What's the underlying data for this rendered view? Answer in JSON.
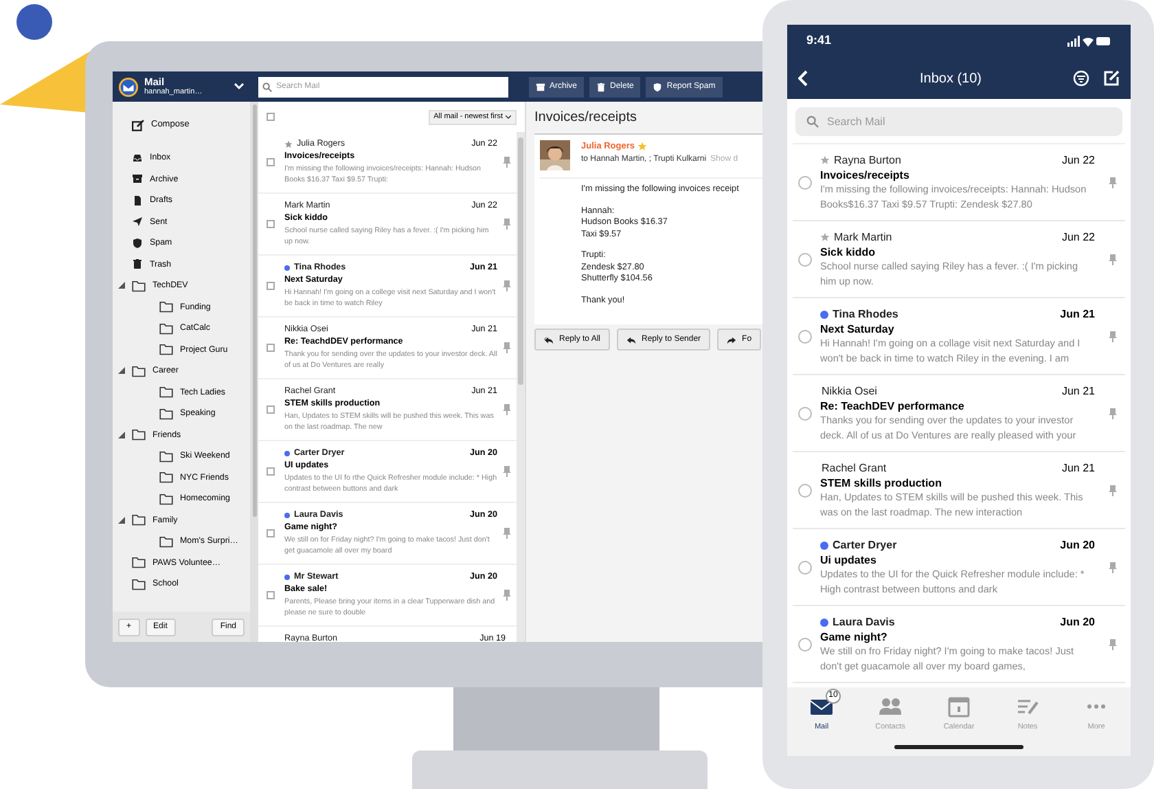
{
  "desktop": {
    "account": {
      "app_name": "Mail",
      "user": "hannah_martin…"
    },
    "search": {
      "placeholder": "Search Mail"
    },
    "toolbar": [
      {
        "label": "Archive"
      },
      {
        "label": "Delete"
      },
      {
        "label": "Report Spam"
      }
    ],
    "sidebar": {
      "compose": "Compose",
      "folders": [
        {
          "label": "Inbox"
        },
        {
          "label": "Archive"
        },
        {
          "label": "Drafts"
        },
        {
          "label": "Sent"
        },
        {
          "label": "Spam"
        },
        {
          "label": "Trash"
        },
        {
          "label": "TechDEV",
          "expanded": true,
          "children": [
            {
              "label": "Funding"
            },
            {
              "label": "CatCalc"
            },
            {
              "label": "Project Guru"
            }
          ]
        },
        {
          "label": "Career",
          "expanded": true,
          "children": [
            {
              "label": "Tech Ladies"
            },
            {
              "label": "Speaking"
            }
          ]
        },
        {
          "label": "Friends",
          "expanded": true,
          "children": [
            {
              "label": "Ski Weekend"
            },
            {
              "label": "NYC Friends"
            },
            {
              "label": "Homecoming"
            }
          ]
        },
        {
          "label": "Family",
          "expanded": true,
          "children": [
            {
              "label": "Mom's Surpri…"
            }
          ]
        },
        {
          "label": "PAWS Voluntee…"
        },
        {
          "label": "School"
        }
      ],
      "buttons": [
        "+",
        "Edit",
        "Find"
      ]
    },
    "message_list": {
      "select_all": {
        "checked": false
      },
      "sort": "All mail - newest first",
      "messages": [
        {
          "sender": "Julia Rogers",
          "date": "Jun 22",
          "subject": "Invoices/receipts",
          "preview": "I'm missing the following invoices/receipts: Hannah: Hudson Books $16.37 Taxi $9.57 Trupti:",
          "unread": false,
          "starred": true,
          "checked": false
        },
        {
          "sender": "Mark Martin",
          "date": "Jun 22",
          "subject": "Sick kiddo",
          "preview": "School nurse called saying Riley has a fever. :( I'm picking him up now.",
          "unread": false,
          "starred": false,
          "checked": false
        },
        {
          "sender": "Tina Rhodes",
          "date": "Jun 21",
          "subject": "Next Saturday",
          "preview": "Hi Hannah! I'm going on a college visit next Saturday and I won't be back in time to watch Riley",
          "unread": true,
          "starred": false,
          "checked": false
        },
        {
          "sender": "Nikkia Osei",
          "date": "Jun 21",
          "subject": "Re: TeachdDEV performance",
          "preview": "Thank you for sending over the updates to your investor deck. All of us at Do Ventures are really",
          "unread": false,
          "starred": false,
          "checked": false
        },
        {
          "sender": "Rachel Grant",
          "date": "Jun 21",
          "subject": "STEM skills production",
          "preview": "Han, Updates to STEM skills will be pushed this week. This was on the last roadmap. The new",
          "unread": false,
          "starred": false,
          "checked": false
        },
        {
          "sender": "Carter Dryer",
          "date": "Jun 20",
          "subject": "UI updates",
          "preview": "Updates to the UI fo rthe Quick Refresher module include: * High contrast between buttons and dark",
          "unread": true,
          "starred": false,
          "checked": false
        },
        {
          "sender": "Laura Davis",
          "date": "Jun 20",
          "subject": "Game night?",
          "preview": "We still on for Friday night? I'm going to make tacos! Just don't get guacamole all over my board",
          "unread": true,
          "starred": false,
          "checked": false
        },
        {
          "sender": "Mr Stewart",
          "date": "Jun 20",
          "subject": "Bake sale!",
          "preview": "Parents, Please bring your items in a clear Tupperware dish and please ne sure to double",
          "unread": true,
          "starred": false,
          "checked": false
        },
        {
          "sender": "Rayna Burton",
          "date": "Jun 19",
          "unread": false,
          "starred": false
        }
      ]
    },
    "reading_pane": {
      "title": "Invoices/receipts",
      "from": "Julia Rogers",
      "starred": true,
      "to": "to Hannah Martin, ; Trupti Kulkarni",
      "show_details": "Show d",
      "body": [
        [
          "I'm missing the following invoices receipt"
        ],
        [
          "Hannah:",
          "Hudson Books $16.37",
          "Taxi $9.57"
        ],
        [
          "Trupti:",
          "Zendesk $27.80",
          "Shutterfly $104.56"
        ],
        [
          "Thank you!"
        ]
      ],
      "actions": [
        {
          "label": "Reply to All"
        },
        {
          "label": "Reply to Sender"
        },
        {
          "label": "Fo"
        }
      ]
    }
  },
  "phone": {
    "time": "9:41",
    "title": "Inbox (10)",
    "search": {
      "placeholder": "Search Mail"
    },
    "messages": [
      {
        "sender": "Rayna Burton",
        "date": "Jun 22",
        "subject": "Invoices/receipts",
        "preview": "I'm missing the following invoices/receipts: Hannah: Hudson Books$16.37 Taxi $9.57 Trupti: Zendesk $27.80",
        "unread": false,
        "starred": true,
        "checked": false
      },
      {
        "sender": "Mark Martin",
        "date": "Jun 22",
        "subject": "Sick kiddo",
        "preview": "School nurse called saying Riley has a fever. :( I'm picking him up now.",
        "unread": false,
        "starred": true,
        "checked": false
      },
      {
        "sender": "Tina Rhodes",
        "date": "Jun 21",
        "subject": "Next Saturday",
        "preview": "Hi Hannah! I'm going on a collage visit next Saturday and I won't be back in time to watch Riley in the evening. I am",
        "unread": true,
        "starred": false,
        "checked": false
      },
      {
        "sender": "Nikkia Osei",
        "date": "Jun 21",
        "subject": "Re: TeachDEV performance",
        "preview": "Thanks you for sending over the updates to your investor deck. All of us at Do Ventures are really pleased with your",
        "unread": false,
        "starred": false,
        "checked": false
      },
      {
        "sender": "Rachel Grant",
        "date": "Jun 21",
        "subject": "STEM skills production",
        "preview": "Han, Updates to STEM skills will be pushed this week. This was on the last roadmap. The new interaction",
        "unread": false,
        "starred": false,
        "checked": false
      },
      {
        "sender": "Carter Dryer",
        "date": "Jun 20",
        "subject": "Ui updates",
        "preview": "Updates to the UI for the Quick Refresher module include: * High contrast between buttons and dark",
        "unread": true,
        "starred": false,
        "checked": false
      },
      {
        "sender": "Laura Davis",
        "date": "Jun 20",
        "subject": "Game night?",
        "preview": "We still on fro Friday night? I'm going to make tacos! Just don't get guacamole all over my board games,",
        "unread": true,
        "starred": false,
        "checked": false
      }
    ],
    "tab_bar": [
      {
        "label": "Mail",
        "selected": true,
        "badge": "10"
      },
      {
        "label": "Contacts",
        "selected": false
      },
      {
        "label": "Calendar",
        "selected": false
      },
      {
        "label": "Notes",
        "selected": false
      },
      {
        "label": "More",
        "selected": false
      }
    ]
  }
}
